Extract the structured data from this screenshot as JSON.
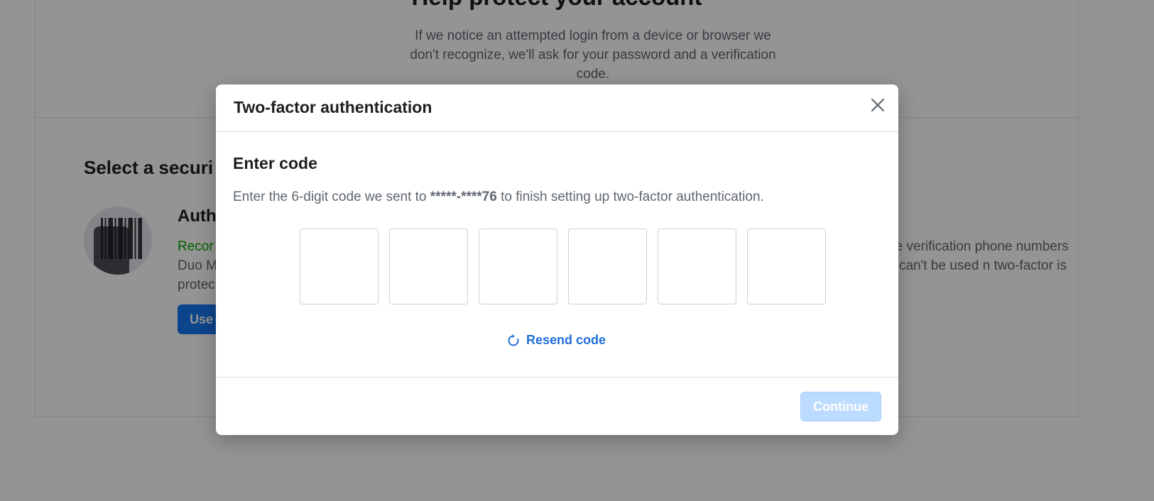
{
  "background": {
    "heading": "Help protect your account",
    "subtitle": "If we notice an attempted login from a device or browser we don't recognize, we'll ask for your password and a verification code.",
    "section_title": "Select a securi",
    "option": {
      "title": "Auth",
      "recommended": "Recor",
      "line2": "Duo M",
      "line3": "protec",
      "button_label": "Use"
    },
    "right_text": "receive verification phone numbers cation can't be used n two-factor is on."
  },
  "modal": {
    "title": "Two-factor authentication",
    "close_icon": "close-icon",
    "heading": "Enter code",
    "instructions_prefix": "Enter the 6-digit code we sent to ",
    "masked_phone": "*****-****76",
    "instructions_suffix": " to finish setting up two-factor authentication.",
    "code_digits": [
      "",
      "",
      "",
      "",
      "",
      ""
    ],
    "resend_icon": "refresh-icon",
    "resend_label": "Resend code",
    "continue_label": "Continue"
  },
  "colors": {
    "link": "#216fdb",
    "continue_disabled_bg": "#bcdcff",
    "overlay": "rgba(0,0,0,0.42)",
    "recommended_green": "#00a400",
    "primary_button": "#1877f2"
  }
}
